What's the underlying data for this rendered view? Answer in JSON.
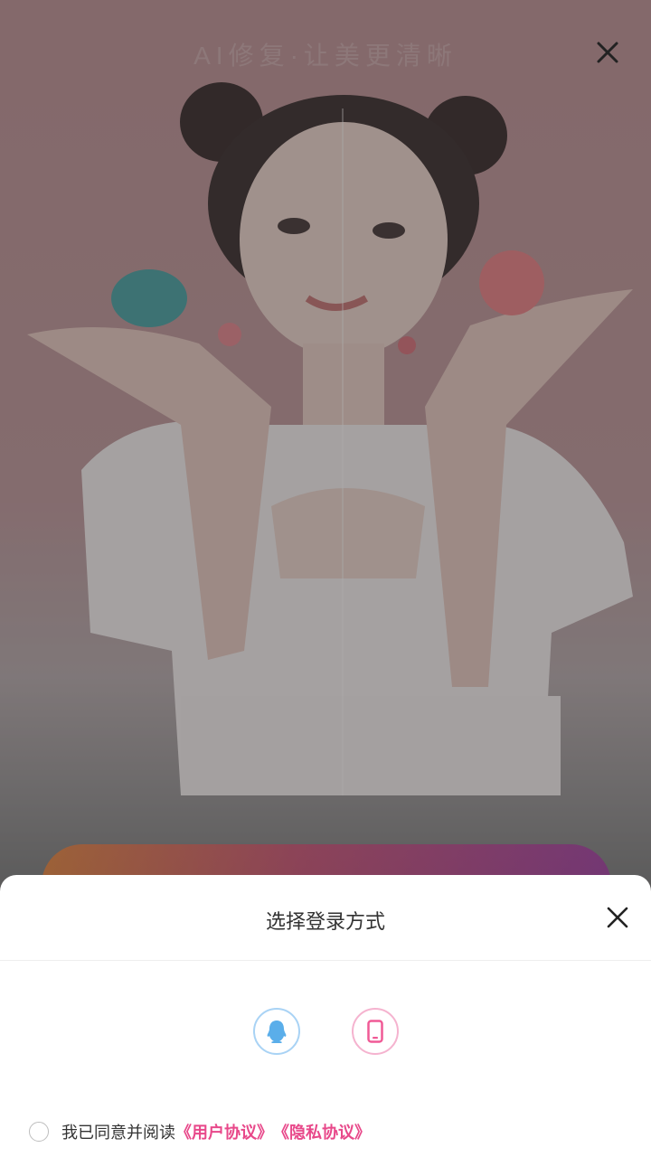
{
  "hero": {
    "title": "AI修复·让美更清晰",
    "close_icon": "close-icon"
  },
  "sheet": {
    "title": "选择登录方式",
    "close_icon": "close-icon",
    "login_options": [
      {
        "icon": "qq-icon",
        "color": "#5aaeea"
      },
      {
        "icon": "phone-icon",
        "color": "#f05a96"
      }
    ],
    "agreement": {
      "prefix": "我已同意并阅读",
      "user_agreement": "《用户协议》",
      "privacy_agreement": "《隐私协议》",
      "link_color": "#e8488a"
    }
  }
}
